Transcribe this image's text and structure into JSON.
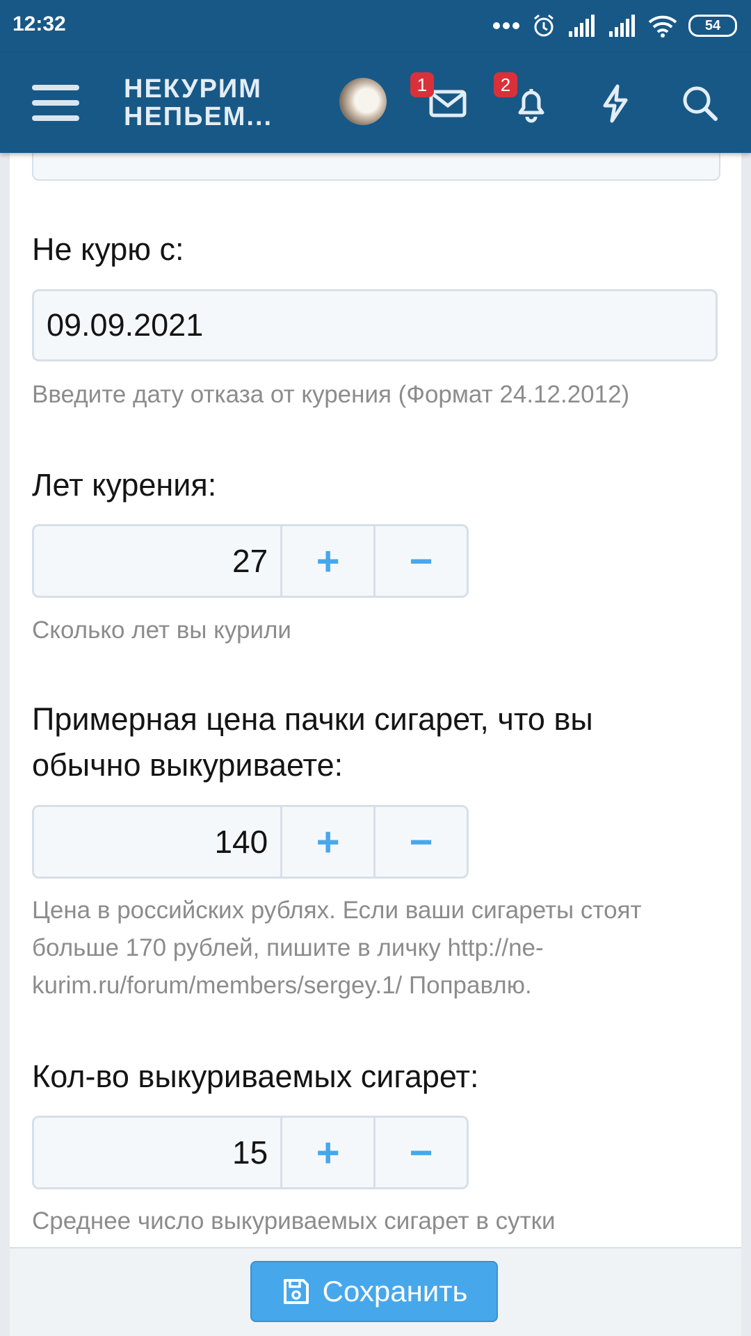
{
  "status_bar": {
    "time": "12:32",
    "battery": "54",
    "icons": [
      "more-dots-icon",
      "alarm-icon",
      "signal-icon",
      "signal-icon",
      "wifi-icon",
      "battery-icon"
    ]
  },
  "header": {
    "logo_line1": "НЕКУРИМ",
    "logo_line2": "НЕПЬЕМ...",
    "messages_badge": "1",
    "alerts_badge": "2",
    "background_color": "#185886"
  },
  "form": {
    "quit_date": {
      "label": "Не курю с:",
      "value": "09.09.2021",
      "hint": "Введите дату отказа от курения (Формат 24.12.2012)"
    },
    "years_smoking": {
      "label": "Лет курения:",
      "value": "27",
      "plus": "+",
      "minus": "−",
      "hint": "Сколько лет вы курили"
    },
    "pack_price": {
      "label": "Примерная цена пачки сигарет, что вы обычно выкуриваете:",
      "value": "140",
      "plus": "+",
      "minus": "−",
      "hint": "Цена в российских рублях. Если ваши сигареты стоят больше 170 рублей, пишите в личку http://ne-kurim.ru/forum/members/sergey.1/ Поправлю."
    },
    "cigarettes_count": {
      "label": "Кол-во выкуриваемых сигарет:",
      "value": "15",
      "plus": "+",
      "minus": "−",
      "hint": "Среднее число выкуриваемых сигарет в сутки"
    }
  },
  "footer": {
    "save_label": "Сохранить",
    "accent_color": "#47a7eb"
  }
}
